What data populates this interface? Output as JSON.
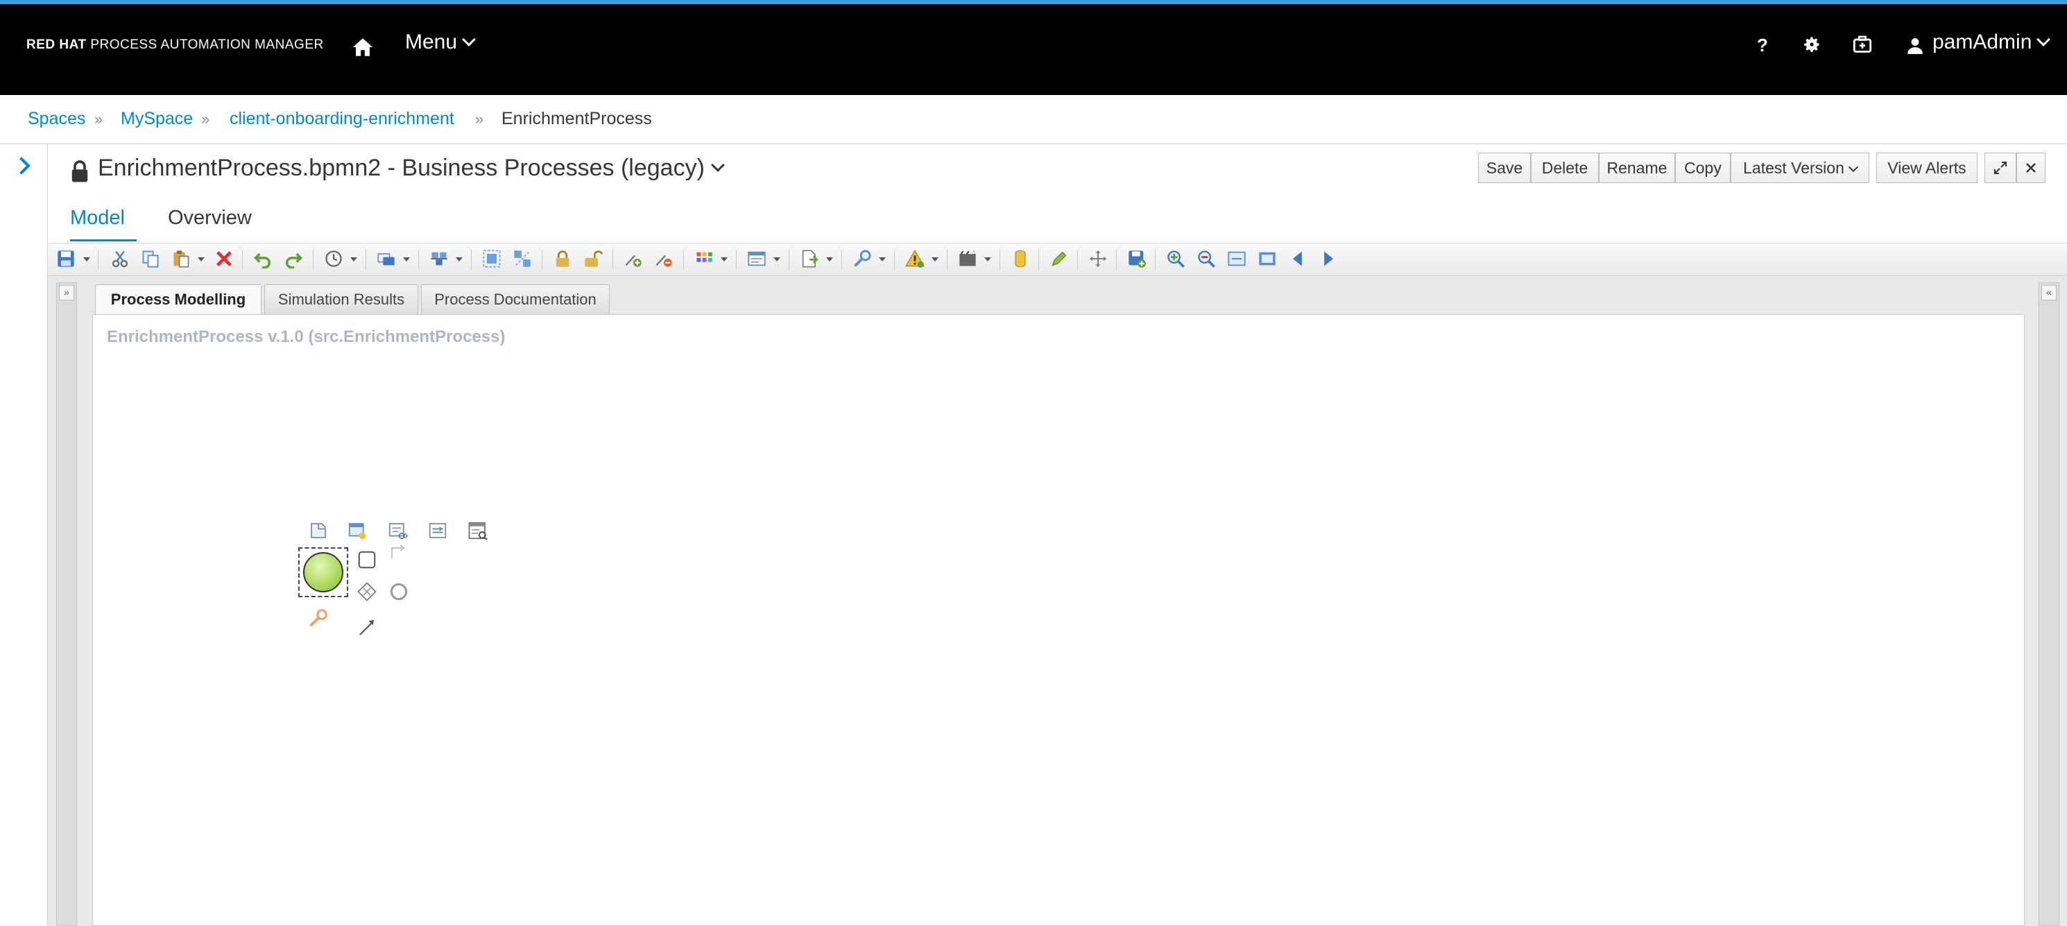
{
  "topbar": {
    "brand_bold": "RED HAT",
    "brand_rest": "PROCESS AUTOMATION MANAGER",
    "menu_label": "Menu",
    "help_label": "?",
    "user_label": "pamAdmin"
  },
  "breadcrumb": {
    "items": [
      "Spaces",
      "MySpace",
      "client-onboarding-enrichment",
      "EnrichmentProcess"
    ],
    "separator": "»"
  },
  "editor": {
    "title": "EnrichmentProcess.bpmn2 - Business Processes (legacy)",
    "buttons": {
      "save": "Save",
      "delete": "Delete",
      "rename": "Rename",
      "copy": "Copy",
      "version": "Latest Version",
      "alerts": "View Alerts"
    },
    "tabs": [
      "Model",
      "Overview"
    ]
  },
  "designer": {
    "subtabs": [
      "Process Modelling",
      "Simulation Results",
      "Process Documentation"
    ],
    "process_label": "EnrichmentProcess v.1.0 (src.EnrichmentProcess)",
    "expand_glyph": "»",
    "collapse_glyph": "«"
  },
  "colors": {
    "accent": "#0088ce",
    "topbar_bg": "#000000",
    "top_stripe": "#39a5dc",
    "start_event": "#a9d95b",
    "process_label": "#a9b8c8",
    "delete_icon": "#e0302a"
  }
}
